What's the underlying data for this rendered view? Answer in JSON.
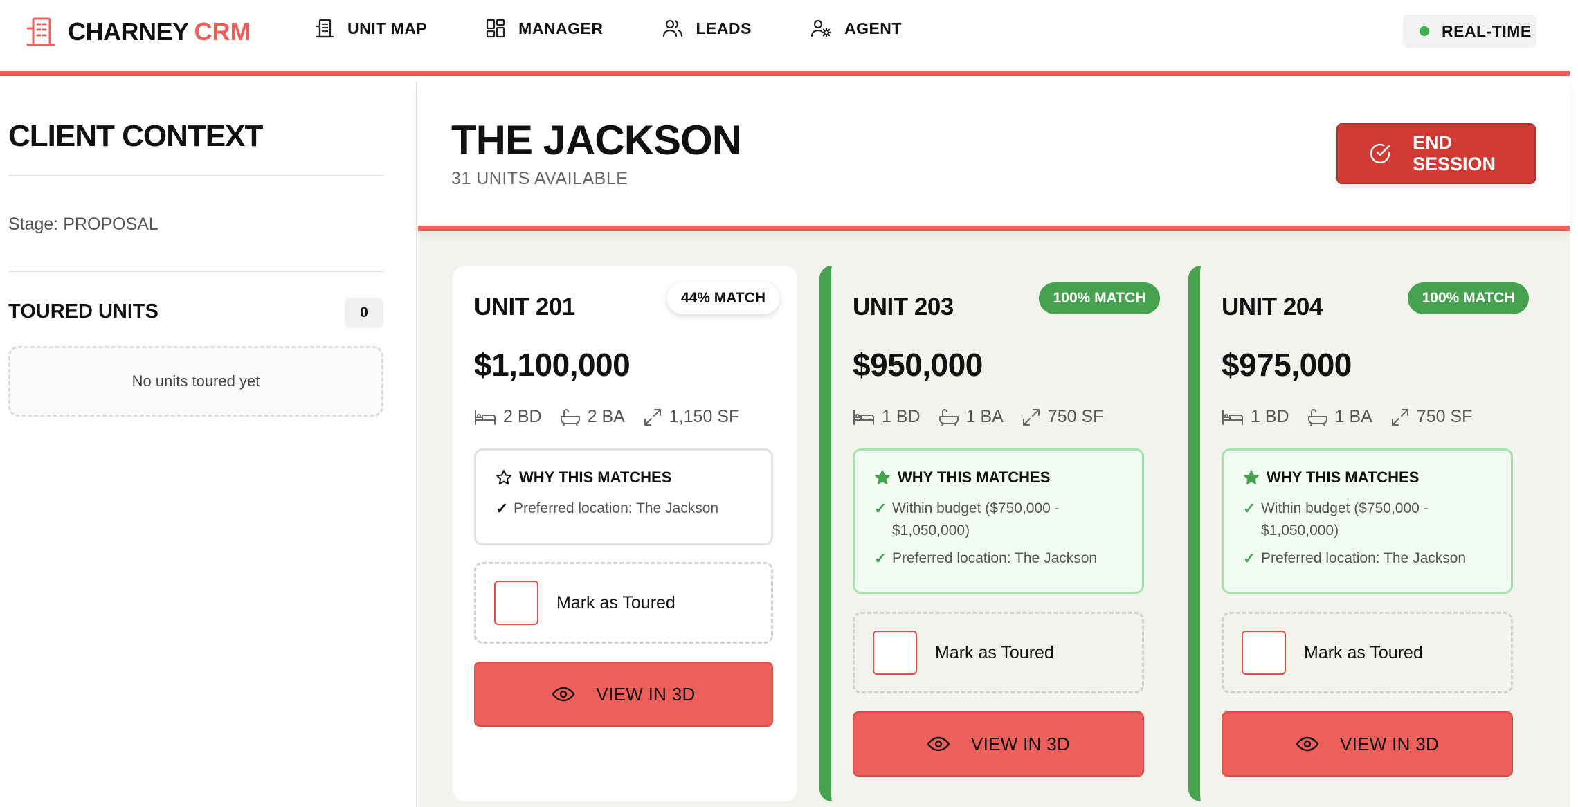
{
  "app": {
    "brand": "CHARNEY",
    "brand_accent": "CRM",
    "accent_color": "#ec5f5a"
  },
  "nav": {
    "items": [
      {
        "label": "UNIT MAP",
        "icon": "building-icon"
      },
      {
        "label": "MANAGER",
        "icon": "grid-icon"
      },
      {
        "label": "LEADS",
        "icon": "users-icon"
      },
      {
        "label": "AGENT",
        "icon": "user-gear-icon"
      }
    ],
    "realtime_label": "REAL-TIME",
    "realtime_color": "#3fae4f"
  },
  "sidebar": {
    "title": "CLIENT CONTEXT",
    "stage": "Stage: PROPOSAL",
    "toured_label": "TOURED UNITS",
    "toured_count": "0",
    "empty_text": "No units toured yet"
  },
  "main": {
    "title": "THE JACKSON",
    "subtitle": "31 UNITS AVAILABLE",
    "end_session_label": "END SESSION"
  },
  "cards": [
    {
      "unit": "UNIT 201",
      "match": "44% MATCH",
      "price": "$1,100,000",
      "beds": "2 BD",
      "baths": "2 BA",
      "size": "1,150 SF",
      "why_title": "WHY THIS MATCHES",
      "reasons": [
        "Preferred location: The Jackson"
      ],
      "toured_label": "Mark as Toured",
      "view_label": "VIEW IN 3D"
    },
    {
      "unit": "UNIT 203",
      "match": "100% MATCH",
      "price": "$950,000",
      "beds": "1 BD",
      "baths": "1 BA",
      "size": "750 SF",
      "why_title": "WHY THIS MATCHES",
      "reasons": [
        "Within budget ($750,000 - $1,050,000)",
        "Preferred location: The Jackson"
      ],
      "toured_label": "Mark as Toured",
      "view_label": "VIEW IN 3D"
    },
    {
      "unit": "UNIT 204",
      "match": "100% MATCH",
      "price": "$975,000",
      "beds": "1 BD",
      "baths": "1 BA",
      "size": "750 SF",
      "why_title": "WHY THIS MATCHES",
      "reasons": [
        "Within budget ($750,000 - $1,050,000)",
        "Preferred location: The Jackson"
      ],
      "toured_label": "Mark as Toured",
      "view_label": "VIEW IN 3D"
    }
  ],
  "colors": {
    "match_green": "#46a24f",
    "end_session_red": "#cf3a34"
  }
}
